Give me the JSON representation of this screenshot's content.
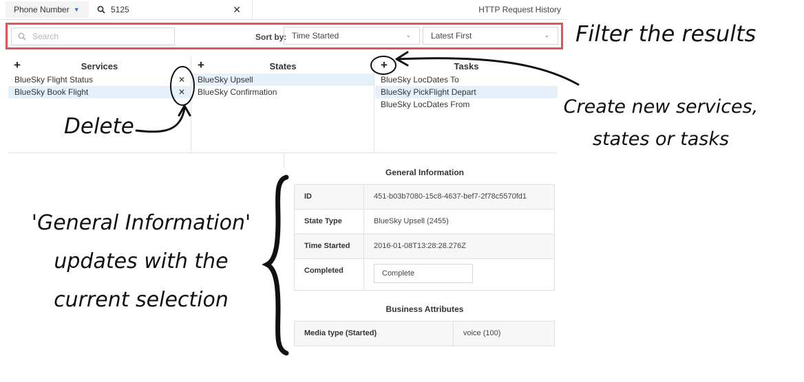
{
  "topbar": {
    "phone_select": "Phone Number",
    "query_value": "5125",
    "history_link": "HTTP Request History"
  },
  "filter": {
    "search_placeholder": "Search",
    "sort_label": "Sort by:",
    "sort_field": "Time Started",
    "sort_order": "Latest First"
  },
  "services": {
    "title": "Services",
    "items": [
      "BlueSky Flight Status",
      "BlueSky Book Flight"
    ]
  },
  "states": {
    "title": "States",
    "items": [
      "BlueSky Upsell",
      "BlueSky Confirmation"
    ]
  },
  "tasks": {
    "title": "Tasks",
    "items": [
      "BlueSky LocDates To",
      "BlueSky PickFlight Depart",
      "BlueSky LocDates From"
    ]
  },
  "general": {
    "title": "General Information",
    "rows": [
      {
        "label": "ID",
        "value": "451-b03b7080-15c8-4637-bef7-2f78c5570fd1"
      },
      {
        "label": "State Type",
        "value": "BlueSky Upsell (2455)"
      },
      {
        "label": "Time Started",
        "value": "2016-01-08T13:28:28.276Z"
      },
      {
        "label": "Completed",
        "value": "Complete"
      }
    ]
  },
  "business": {
    "title": "Business Attributes",
    "rows": [
      {
        "label": "Media type (Started)",
        "value": "voice (100)"
      }
    ]
  },
  "annotations": {
    "filter": "Filter the results",
    "create_line1": "Create new services,",
    "create_line2": "states or tasks",
    "delete": "Delete",
    "general_line1": "'General Information'",
    "general_line2": "updates with  the",
    "general_line3": "current selection"
  },
  "colors": {
    "highlight_border": "#dd5555",
    "selected_row": "#e6f0fb",
    "accent": "#3b6fc4"
  }
}
